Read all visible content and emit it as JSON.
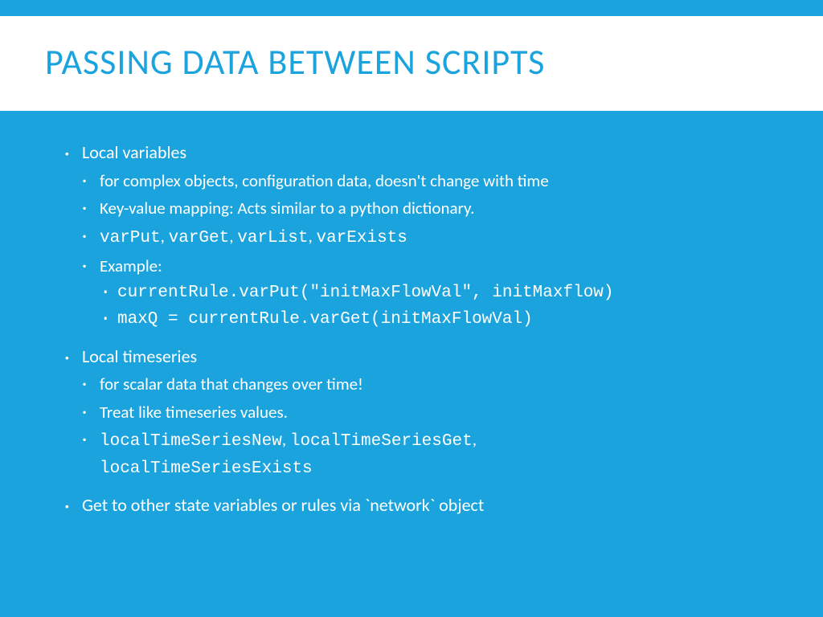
{
  "title": "PASSING DATA BETWEEN SCRIPTS",
  "bullets": {
    "b1": "Local variables",
    "b1_1": "for complex objects, configuration data, doesn't change with time",
    "b1_2": "Key-value mapping: Acts similar to a python dictionary.",
    "b1_3_a": "varPut",
    "b1_3_b": "varGet",
    "b1_3_c": "varList",
    "b1_3_d": "varExists",
    "b1_4": "Example:",
    "b1_4_1": "currentRule.varPut(\"initMaxFlowVal\", initMaxflow)",
    "b1_4_2": "maxQ = currentRule.varGet(initMaxFlowVal)",
    "b2": "Local timeseries",
    "b2_1": "for scalar data that changes over time!",
    "b2_2": "Treat like timeseries values.",
    "b2_3_a": "localTimeSeriesNew",
    "b2_3_b": "localTimeSeriesGet",
    "b2_3_c": "localTimeSeriesExists",
    "b3": "Get to other state variables or rules via `network` object",
    "sep": ", "
  }
}
